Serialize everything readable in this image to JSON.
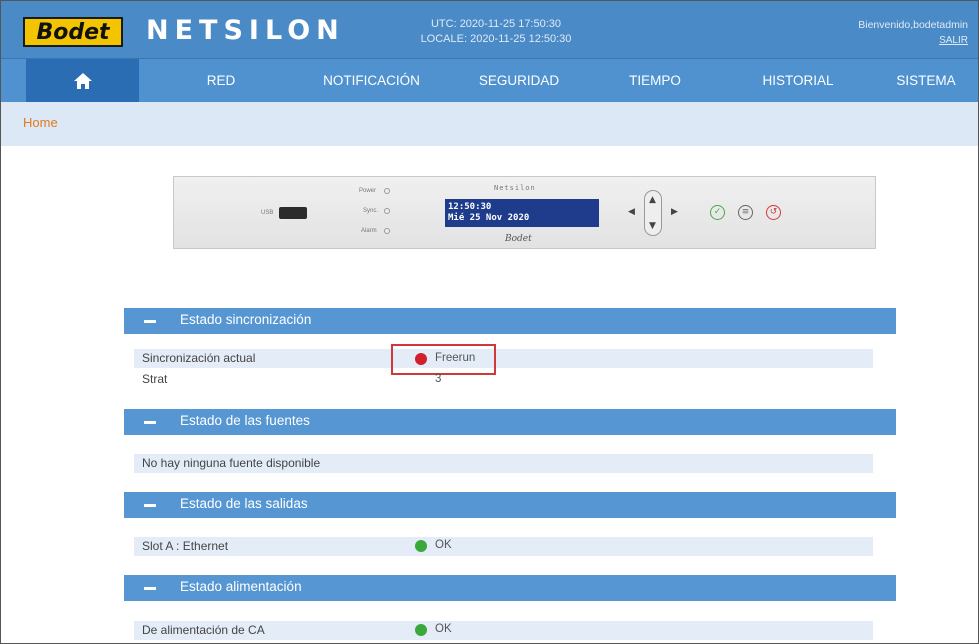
{
  "header": {
    "logo_text": "Bodet",
    "brand": "NETSILON",
    "utc": "UTC: 2020-11-25 17:50:30",
    "local": "LOCALE: 2020-11-25 12:50:30",
    "welcome": "Bienvenido,bodetadmin",
    "logout": "SALIR"
  },
  "nav": {
    "home_icon": "home-icon",
    "items": [
      "RED",
      "NOTIFICACIÓN",
      "SEGURIDAD",
      "TIEMPO",
      "HISTORIAL",
      "SISTEMA"
    ]
  },
  "breadcrumb": {
    "home": "Home"
  },
  "device": {
    "name": "Netsilon",
    "brand": "Bodet",
    "usb_label": "USB",
    "led_labels": [
      "Power",
      "Sync.",
      "Alarm"
    ],
    "lcd_line1": "12:50:30",
    "lcd_line2": "Mié 25 Nov 2020"
  },
  "sections": {
    "sync": {
      "title": "Estado sincronización",
      "current_label": "Sincronización actual",
      "current_value": "Freerun",
      "current_status_color": "#d0202a",
      "strat_label": "Strat",
      "strat_value": "3"
    },
    "sources": {
      "title": "Estado de las fuentes",
      "message": "No hay ninguna fuente disponible"
    },
    "outputs": {
      "title": "Estado de las salidas",
      "slot_label": "Slot A : Ethernet",
      "slot_value": "OK",
      "slot_status_color": "#3aa83a"
    },
    "power": {
      "title": "Estado alimentación",
      "ac_label": "De alimentación de CA",
      "ac_value": "OK",
      "ac_status_color": "#3aa83a"
    }
  },
  "colors": {
    "header_blue": "#4a8ac6",
    "section_blue": "#5596d3",
    "breadcrumb_orange": "#e07a1f",
    "logo_yellow": "#f2c500"
  }
}
